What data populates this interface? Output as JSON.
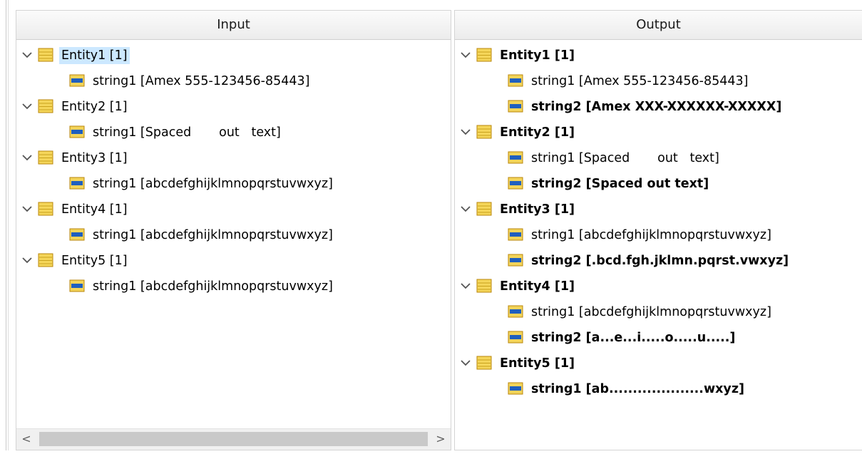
{
  "input": {
    "header": "Input",
    "entities": [
      {
        "label": "Entity1 [1]",
        "selected": true,
        "children": [
          {
            "label": "string1 [Amex 555-123456-85443]",
            "bold": false
          }
        ]
      },
      {
        "label": "Entity2 [1]",
        "children": [
          {
            "label": "string1 [Spaced       out   text]",
            "bold": false
          }
        ]
      },
      {
        "label": "Entity3 [1]",
        "children": [
          {
            "label": "string1 [abcdefghijklmnopqrstuvwxyz]",
            "bold": false
          }
        ]
      },
      {
        "label": "Entity4 [1]",
        "children": [
          {
            "label": "string1 [abcdefghijklmnopqrstuvwxyz]",
            "bold": false
          }
        ]
      },
      {
        "label": "Entity5 [1]",
        "children": [
          {
            "label": "string1 [abcdefghijklmnopqrstuvwxyz]",
            "bold": false
          }
        ]
      }
    ],
    "scrollbar": {
      "left_arrow": "<",
      "right_arrow": ">"
    }
  },
  "output": {
    "header": "Output",
    "entities": [
      {
        "label": "Entity1 [1]",
        "children": [
          {
            "label": "string1 [Amex 555-123456-85443]",
            "bold": false
          },
          {
            "label": "string2 [Amex XXX-XXXXXX-XXXXX]",
            "bold": true
          }
        ]
      },
      {
        "label": "Entity2 [1]",
        "children": [
          {
            "label": "string1 [Spaced       out   text]",
            "bold": false
          },
          {
            "label": "string2 [Spaced out text]",
            "bold": true
          }
        ]
      },
      {
        "label": "Entity3 [1]",
        "children": [
          {
            "label": "string1 [abcdefghijklmnopqrstuvwxyz]",
            "bold": false
          },
          {
            "label": "string2 [.bcd.fgh.jklmn.pqrst.vwxyz]",
            "bold": true
          }
        ]
      },
      {
        "label": "Entity4 [1]",
        "children": [
          {
            "label": "string1 [abcdefghijklmnopqrstuvwxyz]",
            "bold": false
          },
          {
            "label": "string2 [a...e...i.....o.....u.....]",
            "bold": true
          }
        ]
      },
      {
        "label": "Entity5 [1]",
        "children": [
          {
            "label": "string1 [ab....................wxyz]",
            "bold": true
          }
        ]
      }
    ]
  },
  "colors": {
    "entity_icon": "#f5d65a",
    "string_icon": "#1f5fbf",
    "selection": "#cce8ff"
  },
  "icons": {
    "entity": "table-icon",
    "field": "string-field-icon",
    "expander": "chevron-down-icon"
  }
}
